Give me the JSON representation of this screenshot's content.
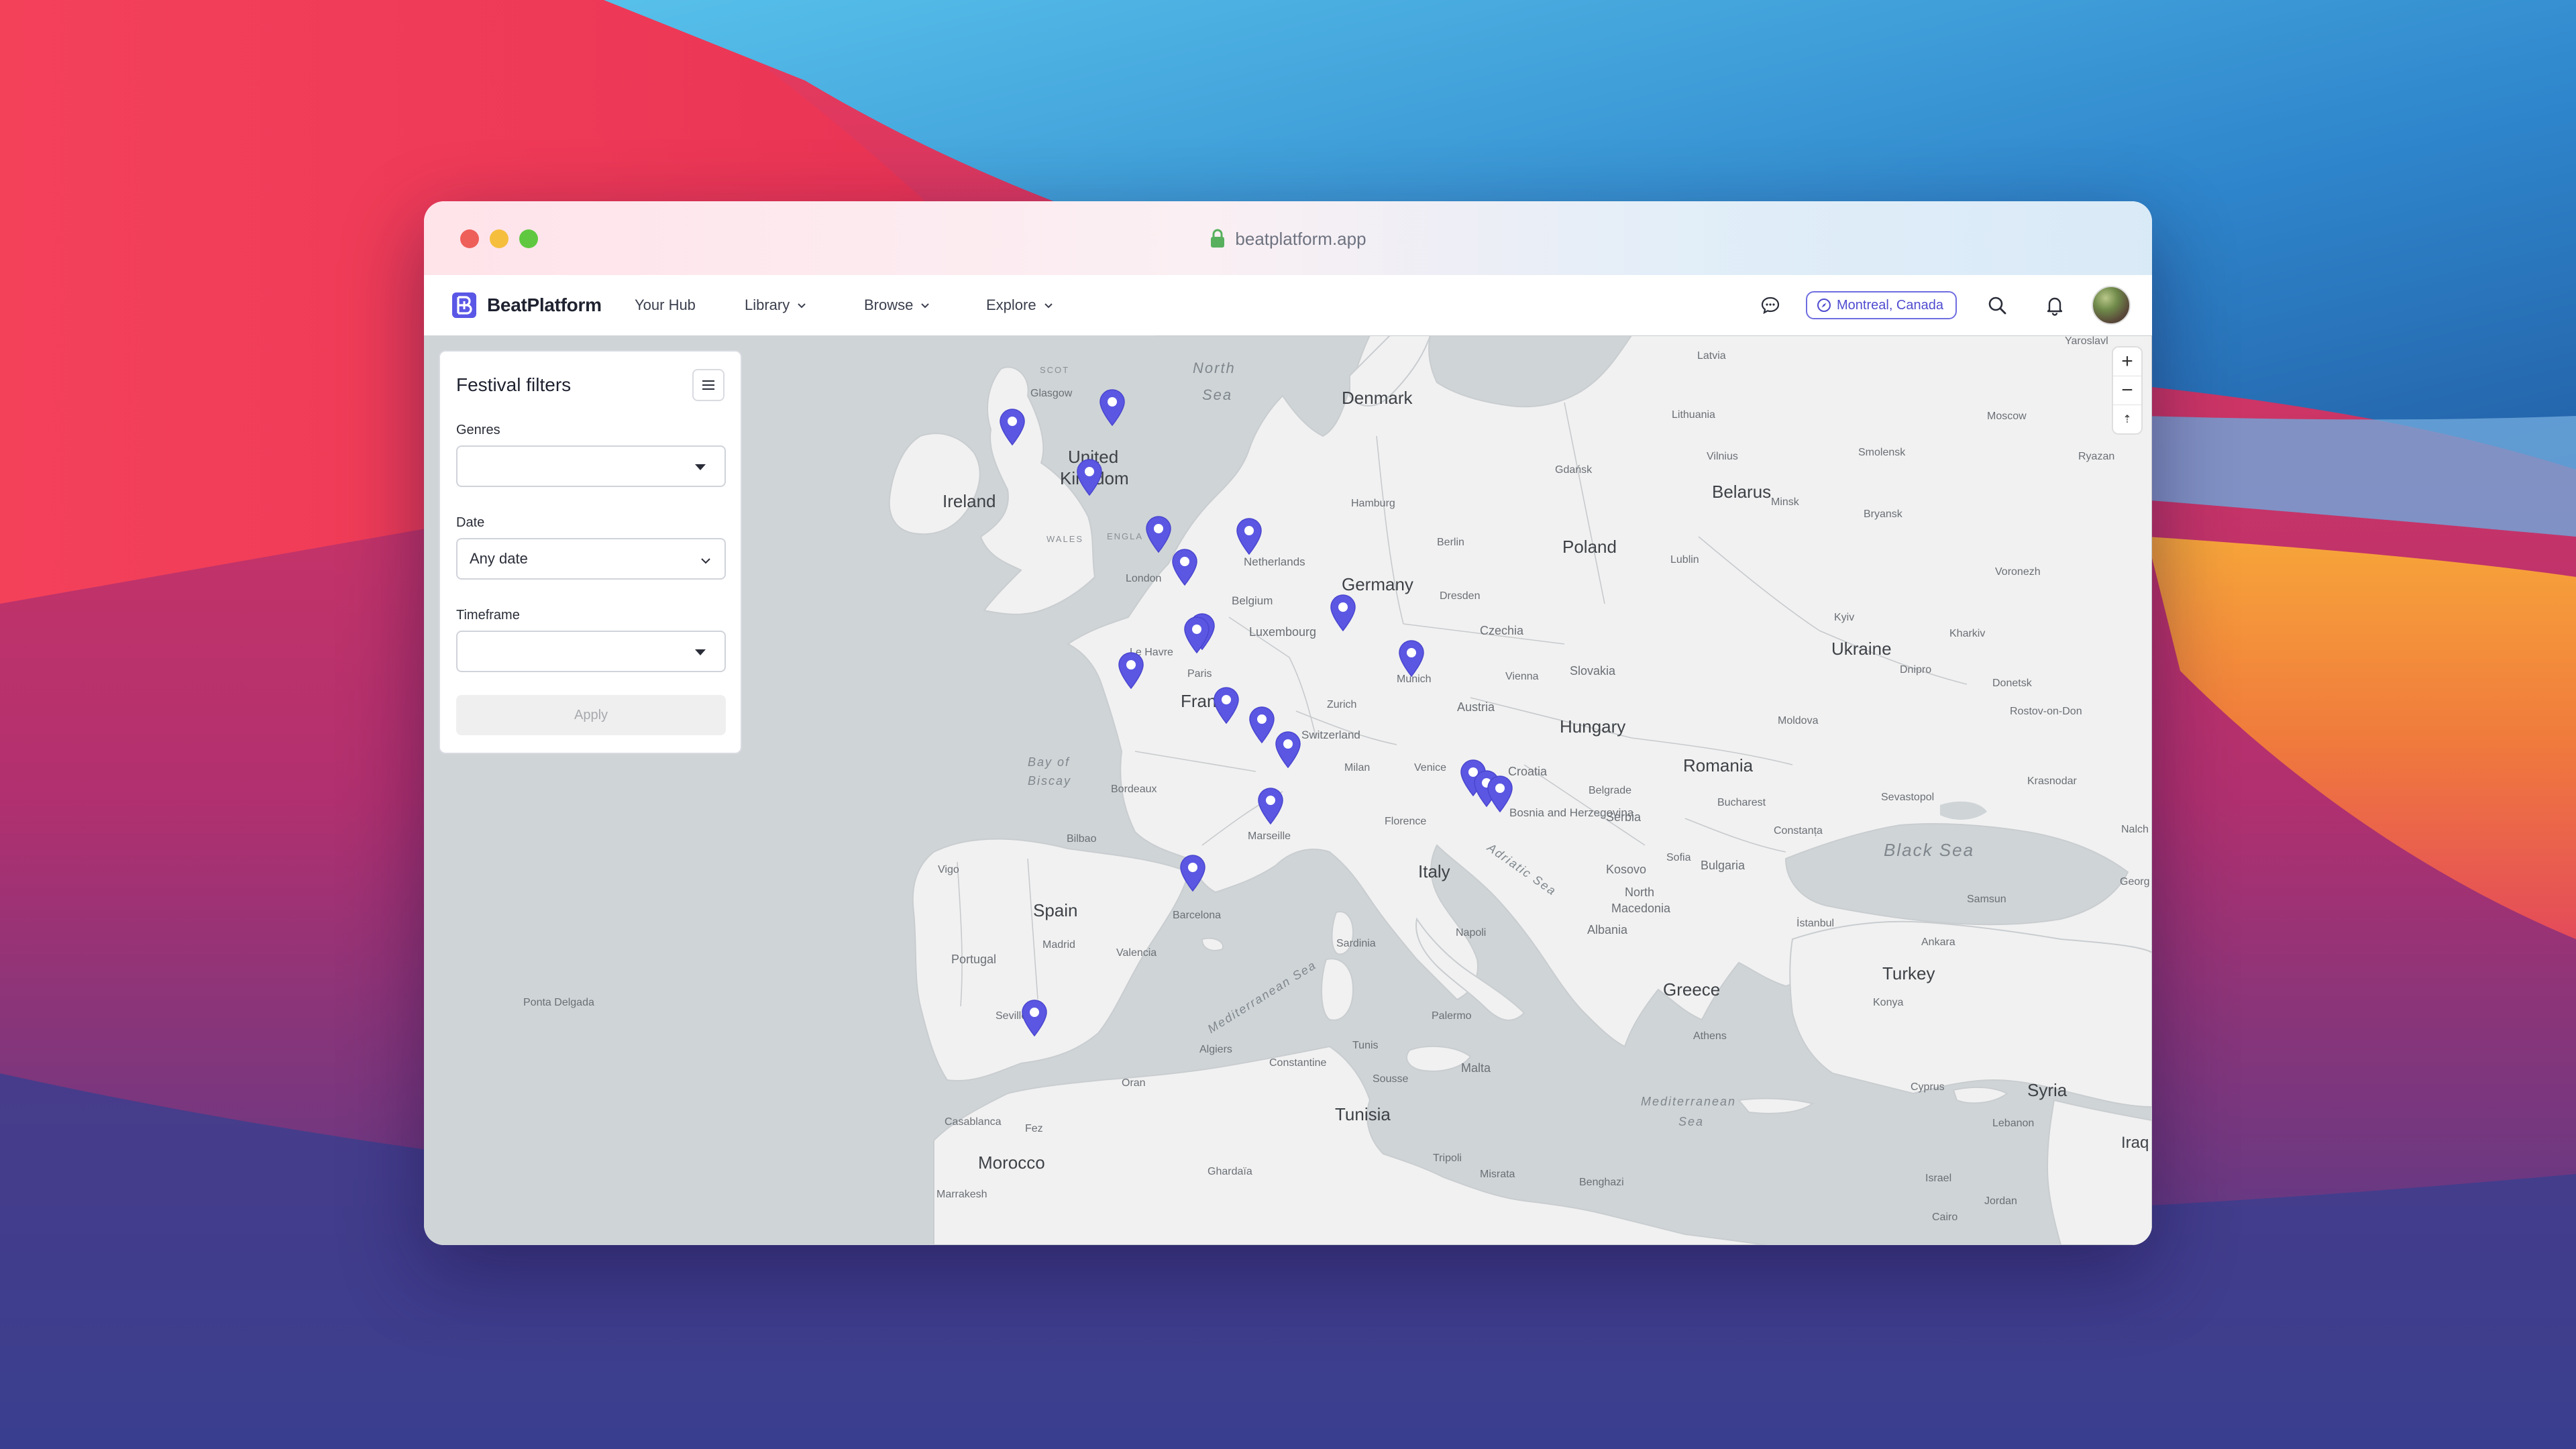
{
  "browser": {
    "url": "beatplatform.app"
  },
  "navbar": {
    "brand": "BeatPlatform",
    "items": [
      {
        "label": "Your Hub",
        "dropdown": false
      },
      {
        "label": "Library",
        "dropdown": true
      },
      {
        "label": "Browse",
        "dropdown": true
      },
      {
        "label": "Explore",
        "dropdown": true
      }
    ],
    "location": "Montreal, Canada",
    "icons": [
      "chat-icon",
      "compass-icon",
      "search-icon",
      "bell-icon",
      "avatar"
    ]
  },
  "filters": {
    "title": "Festival filters",
    "genres_label": "Genres",
    "genres_value": "",
    "date_label": "Date",
    "date_value": "Any date",
    "timeframe_label": "Timeframe",
    "timeframe_value": "",
    "apply_label": "Apply"
  },
  "map": {
    "zoom_in": "+",
    "zoom_out": "−",
    "compass": "⇡",
    "pin_count": 23,
    "labels": {
      "countries": {
        "ireland": "Ireland",
        "uk_line1": "United",
        "uk_line2": "Kingdom",
        "denmark": "Denmark",
        "belarus": "Belarus",
        "poland": "Poland",
        "germany": "Germany",
        "ukraine": "Ukraine",
        "france": "France",
        "hungary": "Hungary",
        "romania": "Romania",
        "italy": "Italy",
        "spain": "Spain",
        "portugal": "Portugal",
        "greece": "Greece",
        "turkey": "Turkey",
        "tunisia": "Tunisia",
        "morocco": "Morocco",
        "syria": "Syria",
        "bulgaria": "Bulgaria",
        "serbia": "Serbia",
        "croatia": "Croatia",
        "czechia": "Czechia",
        "slovakia": "Slovakia",
        "austria": "Austria",
        "switzerland": "Switzerland",
        "belgium": "Belgium",
        "netherlands": "Netherlands",
        "luxembourg": "Luxembourg",
        "lithuania": "Lithuania",
        "latvia": "Latvia",
        "moldova": "Moldova",
        "malta": "Malta",
        "cyprus": "Cyprus",
        "lebanon": "Lebanon",
        "israel": "Israel",
        "jordan": "Jordan",
        "kosovo": "Kosovo",
        "albania": "Albania",
        "north_macedonia_1": "North",
        "north_macedonia_2": "Macedonia",
        "bosnia": "Bosnia and Herzegovina",
        "iraq": "Iraq"
      },
      "seas": {
        "north_sea_1": "North",
        "north_sea_2": "Sea",
        "biscay_1": "Bay of",
        "biscay_2": "Biscay",
        "black_sea": "Black Sea",
        "adriatic": "Adriatic Sea",
        "med_west": "Mediterranean Sea",
        "med_east_1": "Mediterranean",
        "med_east_2": "Sea"
      },
      "regions": {
        "scotland": "SCOT",
        "wales": "WALES",
        "england": "ENGLA"
      },
      "cities": {
        "glasgow": "Glasgow",
        "london": "London",
        "le_havre": "Le Havre",
        "paris": "Paris",
        "bordeaux": "Bordeaux",
        "hamburg": "Hamburg",
        "berlin": "Berlin",
        "dresden": "Dresden",
        "munich": "Munich",
        "vienna": "Vienna",
        "zurich": "Zurich",
        "milan": "Milan",
        "venice": "Venice",
        "florence": "Florence",
        "marseille": "Marseille",
        "barcelona": "Barcelona",
        "valencia": "Valencia",
        "madrid": "Madrid",
        "seville": "Seville",
        "vigo": "Vigo",
        "bilbao": "Bilbao",
        "gdansk": "Gdańsk",
        "vilnius": "Vilnius",
        "minsk": "Minsk",
        "smolensk": "Smolensk",
        "bryansk": "Bryansk",
        "moscow": "Moscow",
        "ryazan": "Ryazan",
        "yaroslavl": "Yaroslavl",
        "voronezh": "Voronezh",
        "kharkiv": "Kharkiv",
        "kyiv": "Kyiv",
        "dnipro": "Dnipro",
        "donetsk": "Donetsk",
        "rostov": "Rostov-on-Don",
        "krasnodar": "Krasnodar",
        "sevastopol": "Sevastopol",
        "constanta": "Constanța",
        "bucharest": "Bucharest",
        "belgrade": "Belgrade",
        "sofia": "Sofia",
        "istanbul": "İstanbul",
        "samsun": "Samsun",
        "ankara": "Ankara",
        "konya": "Konya",
        "athens": "Athens",
        "naples": "Napoli",
        "palermo": "Palermo",
        "sardinia": "Sardinia",
        "algiers": "Algiers",
        "constantine": "Constantine",
        "tunis": "Tunis",
        "sousse": "Sousse",
        "oran": "Oran",
        "fez": "Fez",
        "casablanca": "Casablanca",
        "marrakesh": "Marrakesh",
        "ghardaia": "Ghardaïa",
        "tripoli": "Tripoli",
        "misrata": "Misrata",
        "benghazi": "Benghazi",
        "cairo": "Cairo",
        "ponta_delgada": "Ponta Delgada",
        "nalchik": "Nalch",
        "georgia": "Georg",
        "lublin": "Lublin"
      }
    }
  }
}
